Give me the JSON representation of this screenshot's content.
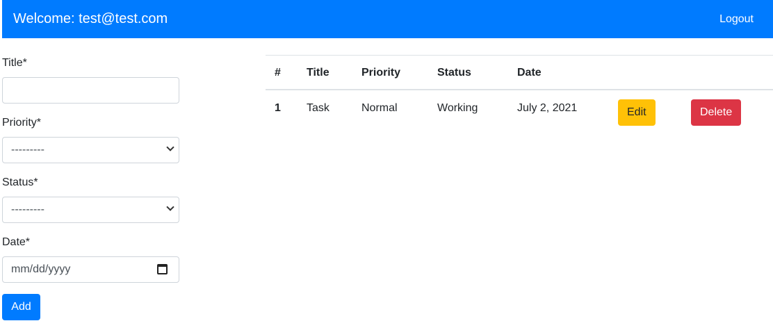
{
  "navbar": {
    "welcome": "Welcome: test@test.com",
    "logout": "Logout",
    "color": "#007bff"
  },
  "form": {
    "title_label": "Title*",
    "title_value": "",
    "priority_label": "Priority*",
    "priority_value": "---------",
    "status_label": "Status*",
    "status_value": "---------",
    "date_label": "Date*",
    "date_placeholder": "mm/dd/yyyy",
    "add_label": "Add"
  },
  "table": {
    "headers": [
      "#",
      "Title",
      "Priority",
      "Status",
      "Date"
    ],
    "rows": [
      {
        "num": "1",
        "title": "Task",
        "priority": "Normal",
        "status": "Working",
        "date": "July 2, 2021",
        "edit": "Edit",
        "delete": "Delete"
      }
    ]
  }
}
